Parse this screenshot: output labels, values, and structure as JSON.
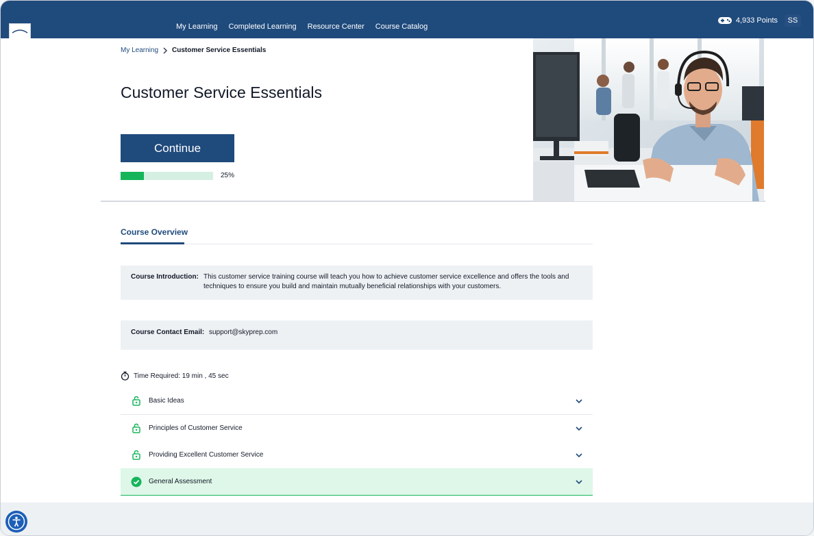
{
  "nav": {
    "items": [
      {
        "label": "My Learning"
      },
      {
        "label": "Completed Learning"
      },
      {
        "label": "Resource Center"
      },
      {
        "label": "Course Catalog"
      }
    ],
    "points": "4,933 Points",
    "avatar_initials": "SS"
  },
  "breadcrumb": {
    "parent": "My Learning",
    "current": "Customer Service Essentials"
  },
  "course": {
    "title": "Customer Service Essentials",
    "continue_label": "Continue",
    "progress_percent": 25,
    "progress_label": "25%"
  },
  "tabs": {
    "overview": "Course Overview"
  },
  "intro": {
    "label": "Course Introduction:",
    "text": "This customer service training course will teach you how to achieve customer service excellence and offers the tools and techniques to ensure you build and maintain mutually beneficial relationships with your customers."
  },
  "contact": {
    "label": "Course Contact Email:",
    "email": "support@skyprep.com"
  },
  "time_required": "Time Required: 19 min , 45 sec",
  "lessons": [
    {
      "title": "Basic Ideas",
      "status": "unlocked"
    },
    {
      "title": "Principles of Customer Service",
      "status": "unlocked"
    },
    {
      "title": "Providing Excellent Customer Service",
      "status": "unlocked"
    },
    {
      "title": "General Assessment",
      "status": "completed"
    }
  ],
  "colors": {
    "brand": "#1f4a7c",
    "progress": "#16b55b",
    "completed_bg": "#dff7e8"
  }
}
